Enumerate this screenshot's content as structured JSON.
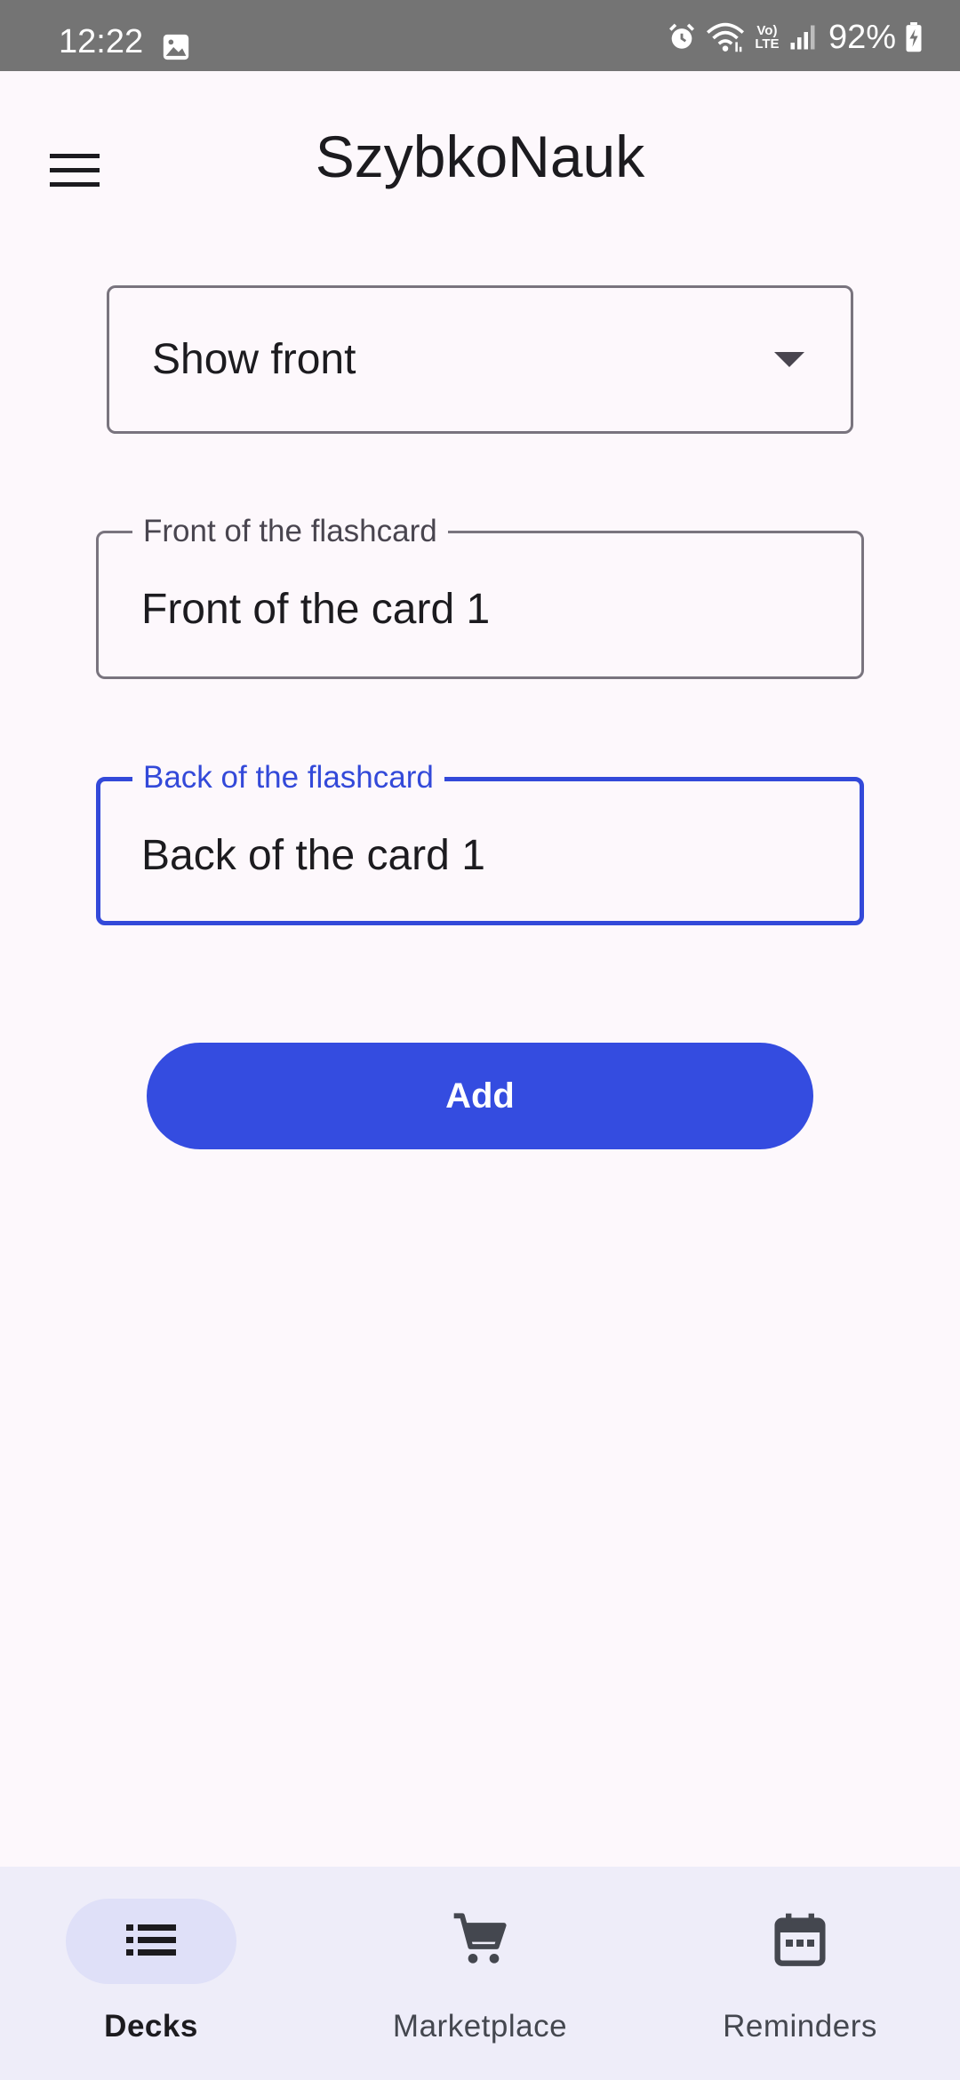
{
  "status_bar": {
    "time": "12:22",
    "battery_percent": "92%",
    "network_badge": "Vo) LTE",
    "icons": [
      "gallery-icon",
      "alarm-icon",
      "wifi-icon",
      "volte-icon",
      "signal-icon",
      "battery-charging-icon"
    ]
  },
  "app_bar": {
    "title": "SzybkoNauk",
    "menu_icon": "hamburger-menu-icon"
  },
  "form": {
    "display_select": {
      "selected": "Show front",
      "icon": "dropdown-arrow-icon"
    },
    "front_field": {
      "label": "Front of the flashcard",
      "value": "Front of the card 1"
    },
    "back_field": {
      "label": "Back of the flashcard",
      "value": "Back of the card 1",
      "focused": true
    },
    "add_button_label": "Add"
  },
  "bottom_nav": {
    "items": [
      {
        "label": "Decks",
        "icon": "list-icon",
        "selected": true
      },
      {
        "label": "Marketplace",
        "icon": "cart-icon",
        "selected": false
      },
      {
        "label": "Reminders",
        "icon": "calendar-icon",
        "selected": false
      }
    ]
  },
  "colors": {
    "accent": "#344ce0",
    "focus_outline": "#3349d9",
    "background": "#fdf8fc",
    "nav_background": "#eeedf9",
    "nav_selected_indicator": "#dfe0f8",
    "status_bar": "#747474"
  }
}
